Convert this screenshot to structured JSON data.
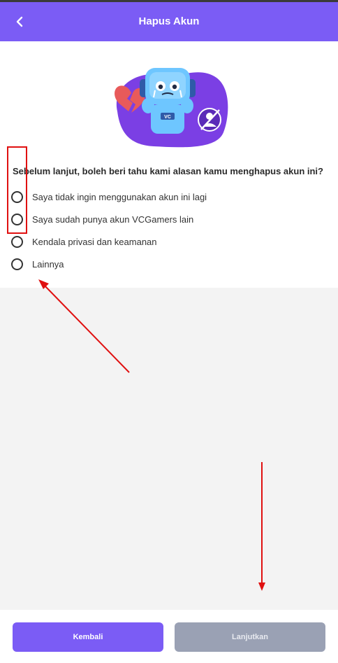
{
  "header": {
    "title": "Hapus Akun"
  },
  "question": "Sebelum lanjut, boleh beri tahu kami alasan kamu menghapus akun ini?",
  "options": [
    {
      "label": "Saya tidak ingin menggunakan akun ini lagi"
    },
    {
      "label": "Saya sudah punya akun VCGamers lain"
    },
    {
      "label": "Kendala privasi dan keamanan"
    },
    {
      "label": "Lainnya"
    }
  ],
  "footer": {
    "back_label": "Kembali",
    "next_label": "Lanjutkan"
  },
  "illustration": {
    "badge_text": "VC"
  },
  "colors": {
    "accent": "#7b5cf5",
    "disabled": "#9aa1b4",
    "annotation": "#e01010"
  }
}
